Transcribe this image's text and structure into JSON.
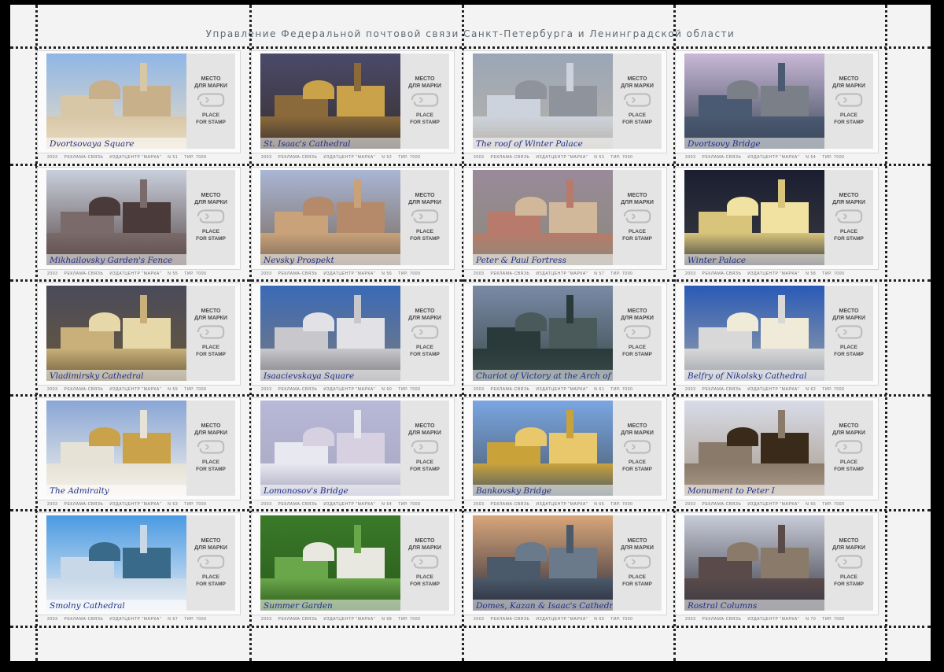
{
  "header": "Управление Федеральной почтовой связи Санкт-Петербурга и Ленинградской области",
  "place_box": {
    "ru_line1": "МЕСТО",
    "ru_line2": "ДЛЯ МАРКИ",
    "en_line1": "PLACE",
    "en_line2": "FOR STAMP",
    "icon": "post-horn-icon"
  },
  "footer": {
    "year": "2003",
    "publisher": "РЕКЛАМА-СВЯЗЬ",
    "center": "ИЗДАТЦЕНТР \"МАРКА\"",
    "print_run": "ТИР. 7000"
  },
  "stamps": [
    {
      "caption": "Dvortsovaya Square",
      "number": "N 51"
    },
    {
      "caption": "St. Isaac's Cathedral",
      "number": "N 52"
    },
    {
      "caption": "The roof of Winter Palace",
      "number": "N 53"
    },
    {
      "caption": "Dvortsovy Bridge",
      "number": "N 54"
    },
    {
      "caption": "Mikhailovsky Garden's Fence",
      "number": "N 55"
    },
    {
      "caption": "Nevsky Prospekt",
      "number": "N 56"
    },
    {
      "caption": "Peter & Paul Fortress",
      "number": "N 57"
    },
    {
      "caption": "Winter Palace",
      "number": "N 58"
    },
    {
      "caption": "Vladimirsky Cathedral",
      "number": "N 59"
    },
    {
      "caption": "Isaacievskaya Square",
      "number": "N 60"
    },
    {
      "caption": "Chariot of Victory at the Arch of the General Staff",
      "number": "N 61"
    },
    {
      "caption": "Belfry of Nikolsky Cathedral",
      "number": "N 62"
    },
    {
      "caption": "The Admiralty",
      "number": "N 63"
    },
    {
      "caption": "Lomonosov's Bridge",
      "number": "N 64"
    },
    {
      "caption": "Bankovsky Bridge",
      "number": "N 65"
    },
    {
      "caption": "Monument to Peter I",
      "number": "N 66"
    },
    {
      "caption": "Smolny Cathedral",
      "number": "N 67"
    },
    {
      "caption": "Summer Garden",
      "number": "N 68"
    },
    {
      "caption": "Domes, Kazan & Isaac's Cathedrals",
      "number": "N 69"
    },
    {
      "caption": "Rostral Columns",
      "number": "N 70"
    }
  ]
}
